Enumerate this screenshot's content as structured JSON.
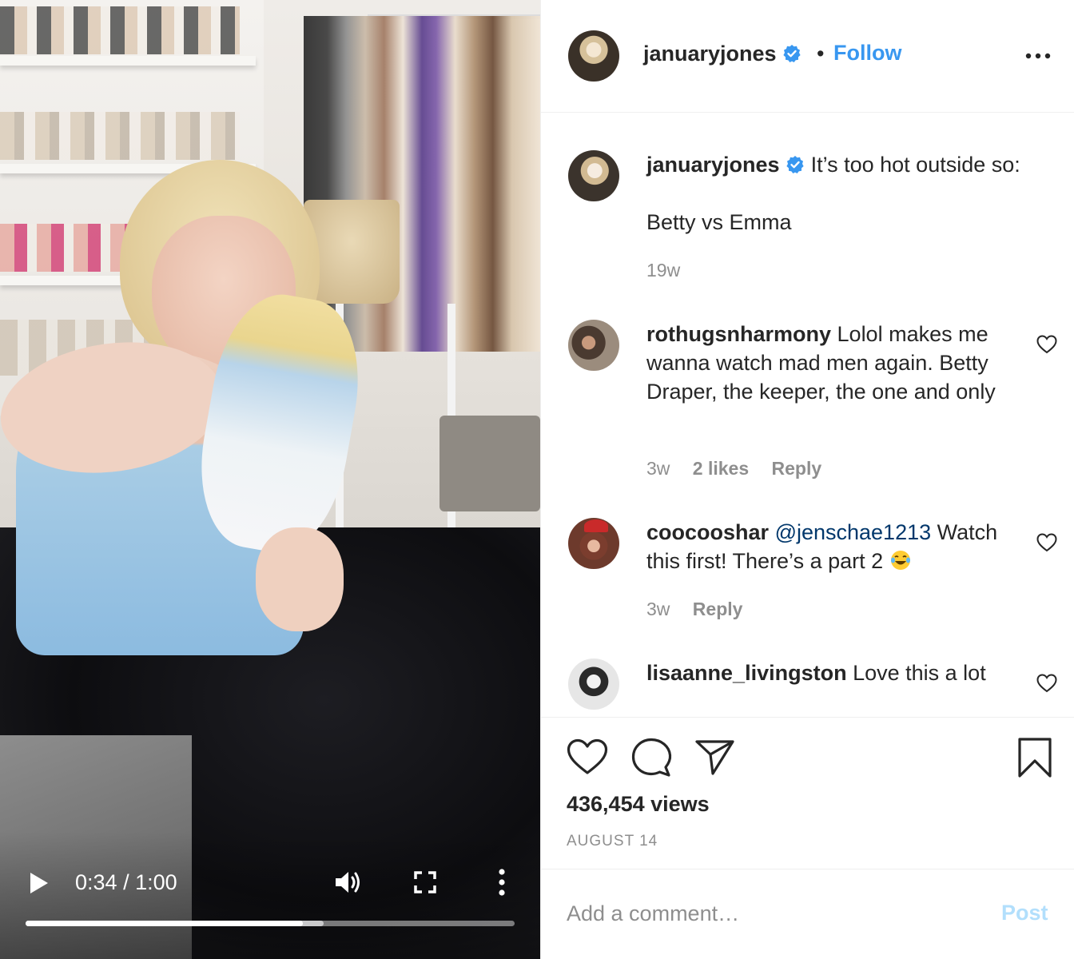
{
  "video": {
    "current_time": "0:34",
    "separator": " / ",
    "duration": "1:00",
    "progress_fraction": 0.567,
    "buffered_fraction": 0.61
  },
  "header": {
    "username": "januaryjones",
    "verified": true,
    "dot": "•",
    "follow_label": "Follow",
    "options_icon": "more-horizontal-icon"
  },
  "caption": {
    "username": "januaryjones",
    "text_line1": "It’s too hot outside so:",
    "text_line2": "Betty vs Emma",
    "age": "19w"
  },
  "comments": [
    {
      "username": "rothugsnharmony",
      "text": "Lolol makes me wanna watch mad men again. Betty Draper, the keeper, the one and only",
      "age": "3w",
      "likes": "2 likes",
      "reply": "Reply"
    },
    {
      "username": "coocooshar",
      "mention": "@jenschae1213",
      "text": "Watch this first! There’s a part 2",
      "emoji": "laughing-crying-emoji",
      "age": "3w",
      "reply": "Reply"
    },
    {
      "username": "lisaanne_livingston",
      "text": "Love this a lot"
    }
  ],
  "actions": {
    "like_icon": "heart-icon",
    "comment_icon": "speech-bubble-icon",
    "share_icon": "paper-plane-icon",
    "save_icon": "bookmark-icon"
  },
  "views": "436,454 views",
  "date": "AUGUST 14",
  "add_comment": {
    "placeholder": "Add a comment…",
    "post_label": "Post"
  },
  "colors": {
    "accent": "#3897f0",
    "post_disabled": "#b2dffc",
    "muted": "#8e8e8e",
    "text": "#262626"
  }
}
